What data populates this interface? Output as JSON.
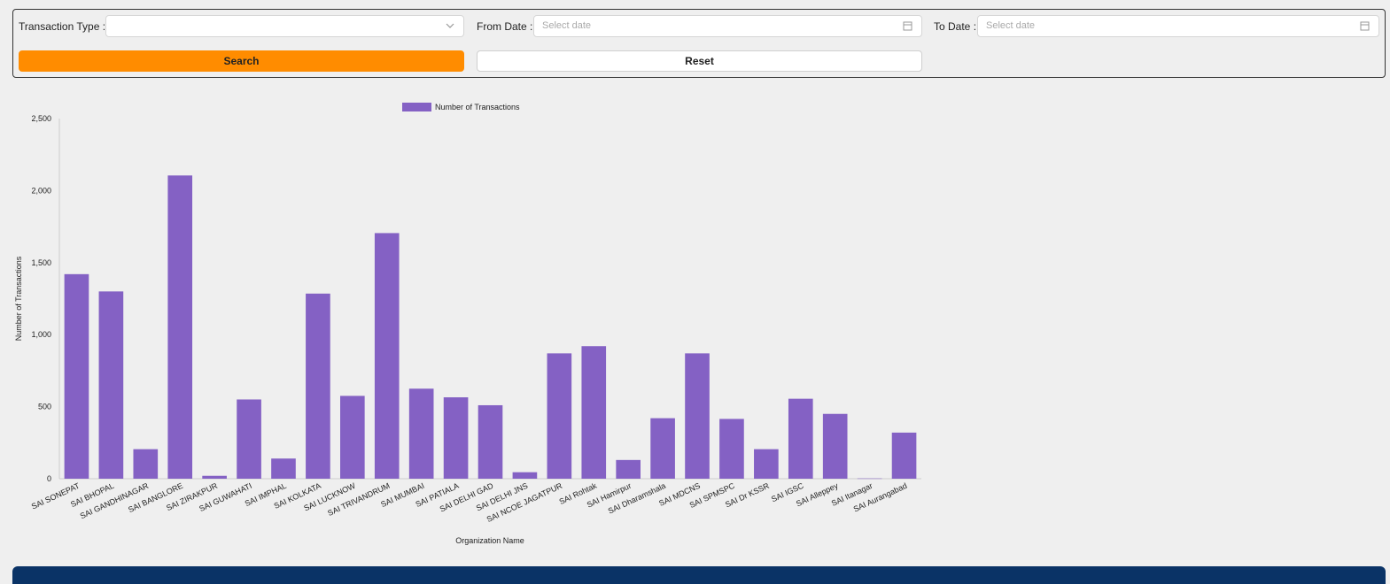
{
  "filters": {
    "transaction_type_label": "Transaction Type :",
    "transaction_type_value": "",
    "from_date_label": "From Date :",
    "from_date_placeholder": "Select date",
    "to_date_label": "To Date :",
    "to_date_placeholder": "Select date",
    "search_label": "Search",
    "reset_label": "Reset",
    "icons": {
      "dropdown": "chevron-down-icon",
      "date": "calendar-icon"
    }
  },
  "colors": {
    "accent": "#ff8c00",
    "bar": "#8461c4",
    "footer": "#0a3366"
  },
  "chart_data": {
    "type": "bar",
    "title": "",
    "legend": "Number of Transactions",
    "legend_position": "top",
    "xlabel": "Organization Name",
    "ylabel": "Number of Transactions",
    "ylim": [
      0,
      2500
    ],
    "yticks": [
      "0",
      "500",
      "1,000",
      "1,500",
      "2,000",
      "2,500"
    ],
    "grid": false,
    "categories": [
      "SAI SONEPAT",
      "SAI BHOPAL",
      "SAI GANDHINAGAR",
      "SAI BANGLORE",
      "SAI ZIRAKPUR",
      "SAI GUWAHATI",
      "SAI IMPHAL",
      "SAI KOLKATA",
      "SAI LUCKNOW",
      "SAI TRIVANDRUM",
      "SAI MUMBAI",
      "SAI PATIALA",
      "SAI DELHI GAD",
      "SAI DELHI JNS",
      "SAI NCOE JAGATPUR",
      "SAI Rohtak",
      "SAI Hamirpur",
      "SAI Dharamshala",
      "SAI MDCNS",
      "SAI SPMSPC",
      "SAI Dr KSSR",
      "SAI IGSC",
      "SAI Alleppey",
      "SAI Itanagar",
      "SAI Aurangabad"
    ],
    "values": [
      1420,
      1300,
      205,
      2105,
      20,
      550,
      140,
      1285,
      575,
      1705,
      625,
      565,
      510,
      45,
      870,
      920,
      130,
      420,
      870,
      415,
      205,
      555,
      450,
      2,
      320
    ]
  }
}
